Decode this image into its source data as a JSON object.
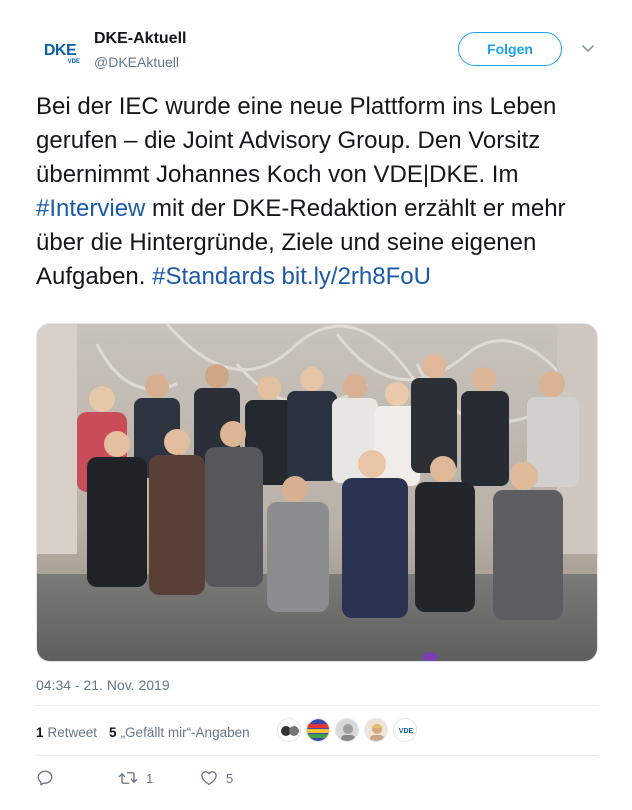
{
  "account": {
    "name": "DKE-Aktuell",
    "handle": "@DKEAktuell",
    "logo_text": "DKE",
    "logo_sub": "VDE"
  },
  "follow_label": "Folgen",
  "tweet": {
    "text_1": "Bei der IEC wurde eine neue Plattform ins Leben gerufen – die Joint Advisory Group. Den Vorsitz übernimmt Johannes Koch von VDE|DKE. Im ",
    "hashtag_1": "#Interview",
    "text_2": " mit der DKE-Redaktion erzählt er mehr über die Hintergründe, Ziele und seine eigenen Aufgaben. ",
    "hashtag_2": "#Standards",
    "text_3": " ",
    "link": "bit.ly/2rh8FoU"
  },
  "timestamp": "04:34 - 21. Nov. 2019",
  "stats": {
    "retweets_count": "1",
    "retweets_label": "Retweet",
    "likes_count": "5",
    "likes_label": "„Gefällt mir“-Angaben"
  },
  "liker_badge_text": "VDE",
  "actions": {
    "reply_count": "",
    "retweet_count": "1",
    "like_count": "5"
  },
  "colors": {
    "accent": "#1da1f2",
    "link": "#1b5aa8",
    "muted": "#657786",
    "brand": "#0b5fa5"
  },
  "icons": [
    "chevron-down-icon",
    "reply-icon",
    "retweet-icon",
    "heart-icon"
  ]
}
